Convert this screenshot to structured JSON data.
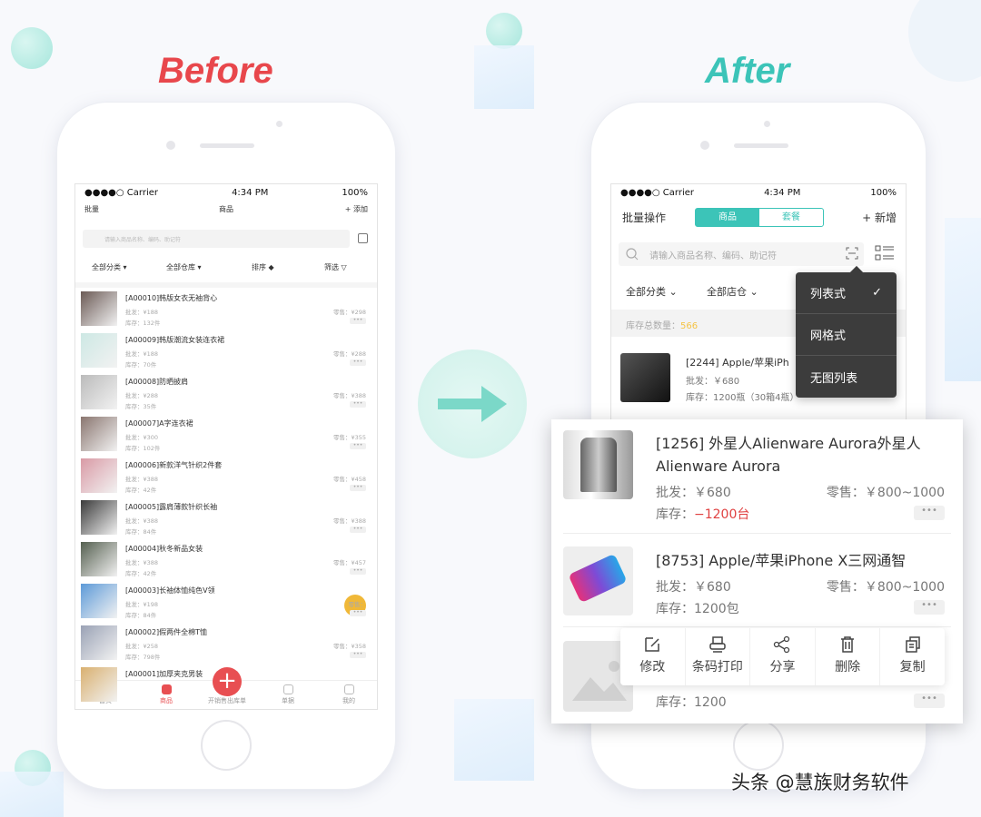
{
  "before_label": "Before",
  "after_label": "After",
  "colors": {
    "before": "#e8474c",
    "after": "#3cc4b8",
    "accent_red": "#e84f52",
    "teal": "#3cc4b8",
    "stock_highlight": "#f5c445",
    "negative": "#e04040"
  },
  "status": {
    "carrier": "●●●●○ Carrier",
    "time": "4:34 PM",
    "battery": "100%"
  },
  "before": {
    "header": {
      "left": "批量",
      "title": "商品",
      "right": "+ 添加"
    },
    "search_placeholder": "请输入商品名称、编码、助记符",
    "filters": [
      "全部分类 ▾",
      "全部仓库 ▾",
      "排序 ◆",
      "筛选 ▽"
    ],
    "items": [
      {
        "name": "[A00010]韩版女衣无袖背心",
        "wholesale": "批发：¥188",
        "retail": "零售：¥298",
        "stock": "库存：132件"
      },
      {
        "name": "[A00009]韩版潮流女装连衣裙",
        "wholesale": "批发：¥188",
        "retail": "零售：¥288",
        "stock": "库存：70件"
      },
      {
        "name": "[A00008]防晒披肩",
        "wholesale": "批发：¥288",
        "retail": "零售：¥388",
        "stock": "库存：35件"
      },
      {
        "name": "[A00007]A字连衣裙",
        "wholesale": "批发：¥300",
        "retail": "零售：¥355",
        "stock": "库存：102件"
      },
      {
        "name": "[A00006]新款洋气针织2件套",
        "wholesale": "批发：¥388",
        "retail": "零售：¥458",
        "stock": "库存：42件"
      },
      {
        "name": "[A00005]露肩薄款针织长袖",
        "wholesale": "批发：¥388",
        "retail": "零售：¥388",
        "stock": "库存：84件"
      },
      {
        "name": "[A00004]秋冬新品女装",
        "wholesale": "批发：¥388",
        "retail": "零售：¥457",
        "stock": "库存：42件"
      },
      {
        "name": "[A00003]长袖体恤纯色V领",
        "wholesale": "批发：¥198",
        "retail": "零售：",
        "stock": "库存：84件"
      },
      {
        "name": "[A00002]假两件全棉T恤",
        "wholesale": "批发：¥258",
        "retail": "零售：¥358",
        "stock": "库存：798件"
      },
      {
        "name": "[A00001]加厚夹克男装",
        "wholesale": "",
        "retail": "",
        "stock": ""
      }
    ],
    "tabs": [
      {
        "label": "首页",
        "icon": "home-icon"
      },
      {
        "label": "商品",
        "icon": "goods-icon",
        "active": true
      },
      {
        "label": "开销售出库单",
        "icon": "plus-icon"
      },
      {
        "label": "单据",
        "icon": "document-icon"
      },
      {
        "label": "我的",
        "icon": "user-icon"
      }
    ]
  },
  "after": {
    "header": {
      "left": "批量操作",
      "seg": [
        "商品",
        "套餐"
      ],
      "right": "+ 新增"
    },
    "search_placeholder": "请输入商品名称、编码、助记符",
    "filters": [
      "全部分类 ⌄",
      "全部店仓 ⌄"
    ],
    "stock_label": "库存总数量：",
    "stock_value": "566",
    "item": {
      "name": "[2244] Apple/苹果iPh",
      "wholesale": "批发：￥680",
      "stock": "库存：1200瓶（30箱4瓶）"
    },
    "view_menu": [
      {
        "label": "列表式",
        "checked": true
      },
      {
        "label": "网格式"
      },
      {
        "label": "无图列表"
      }
    ],
    "cards": [
      {
        "name": "[1256] 外星人Alienware Aurora外星人Alienware Aurora",
        "wholesale": "批发：￥680",
        "retail": "零售：￥800~1000",
        "stock": "库存：",
        "stock_value": "−1200台"
      },
      {
        "name": "[8753] Apple/苹果iPhone X三网通智",
        "wholesale": "批发：￥680",
        "retail": "零售：￥800~1000",
        "stock": "库存：1200包"
      },
      {
        "stock": "库存：1200"
      }
    ],
    "actions": [
      {
        "label": "修改",
        "icon": "edit-icon"
      },
      {
        "label": "条码打印",
        "icon": "printer-icon"
      },
      {
        "label": "分享",
        "icon": "share-icon"
      },
      {
        "label": "删除",
        "icon": "trash-icon"
      },
      {
        "label": "复制",
        "icon": "copy-icon"
      }
    ]
  },
  "watermark": "头条 @慧族财务软件"
}
